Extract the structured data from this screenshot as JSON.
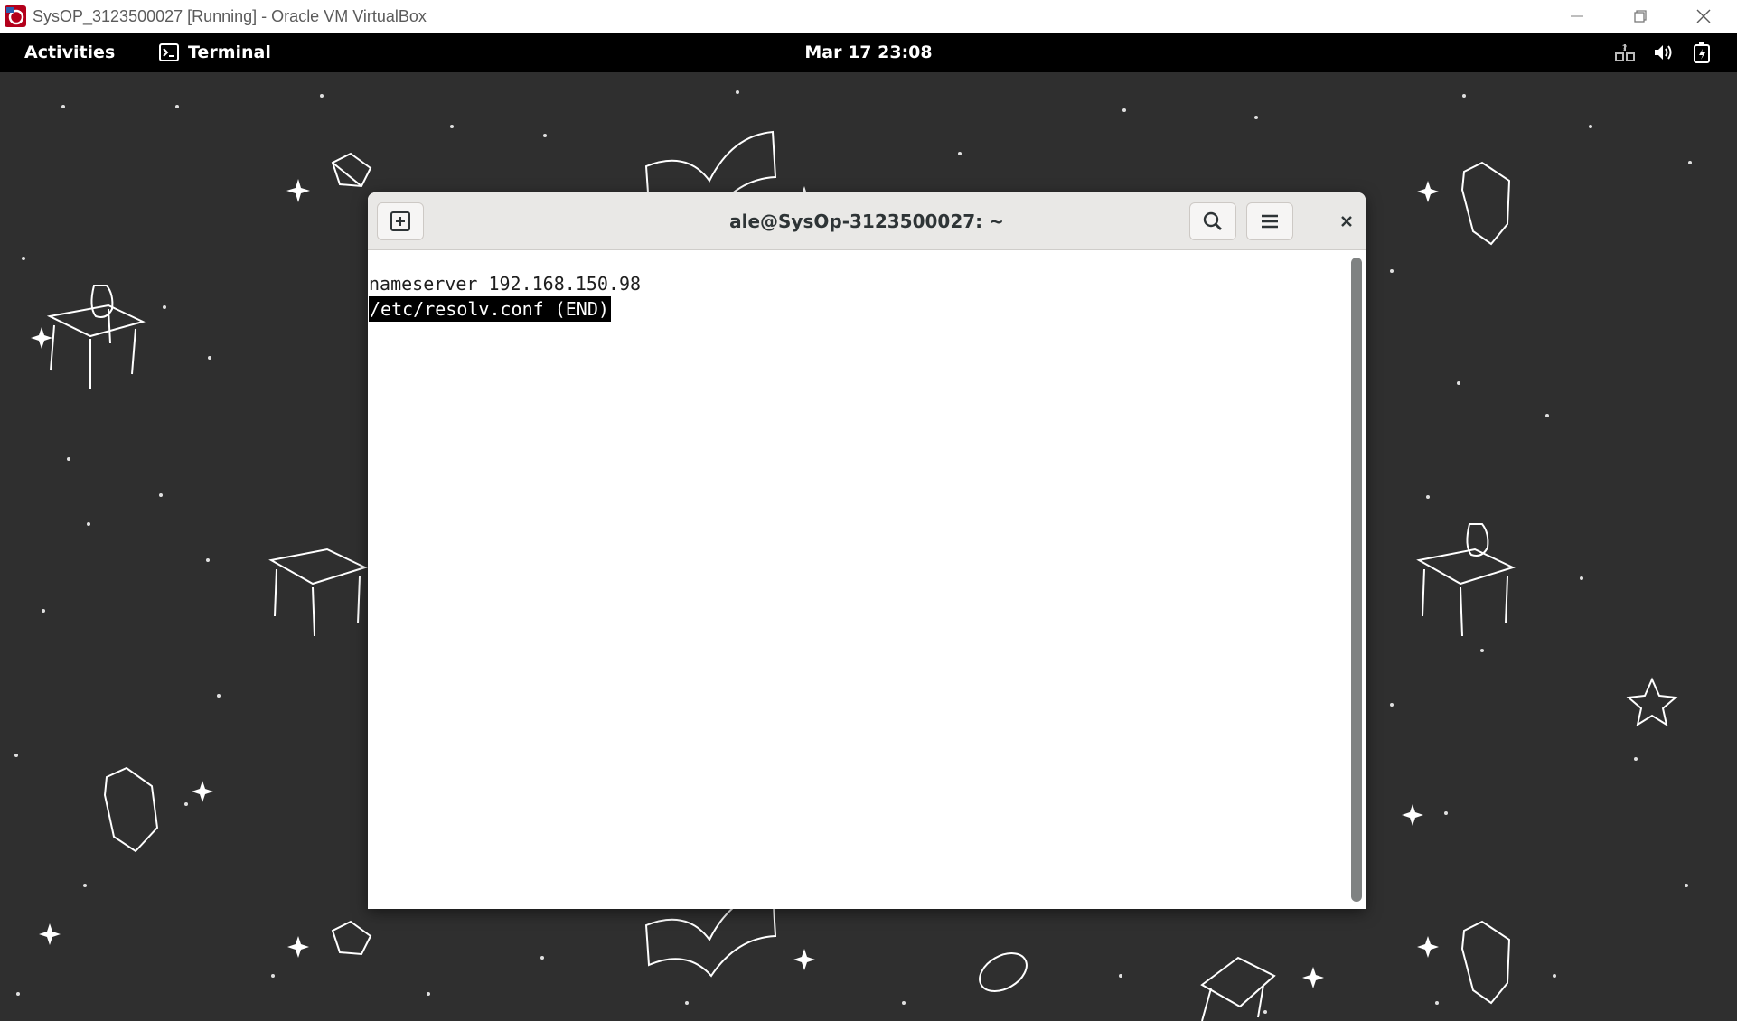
{
  "host_window": {
    "title": "SysOP_3123500027 [Running] - Oracle VM VirtualBox",
    "app_icon": "virtualbox-icon",
    "controls": [
      "minimize-icon",
      "restore-icon",
      "close-icon"
    ]
  },
  "topbar": {
    "activities_label": "Activities",
    "app_label": "Terminal",
    "app_icon": "terminal-icon",
    "clock": "Mar 17  23:08",
    "tray_icons": [
      "network-icon",
      "volume-icon",
      "battery-icon"
    ]
  },
  "terminal": {
    "title": "ale@SysOp-3123500027: ~",
    "header_buttons": [
      "new-tab-icon",
      "search-icon",
      "hamburger-menu-icon",
      "close-icon"
    ],
    "lines": [
      "nameserver 192.168.150.98",
      "/etc/resolv.conf (END)"
    ]
  },
  "colors": {
    "desktop_background": "#2f2f2f",
    "topbar": "#000000",
    "terminal_header": "#e9e8e6",
    "pager_status_bg": "#000000"
  }
}
